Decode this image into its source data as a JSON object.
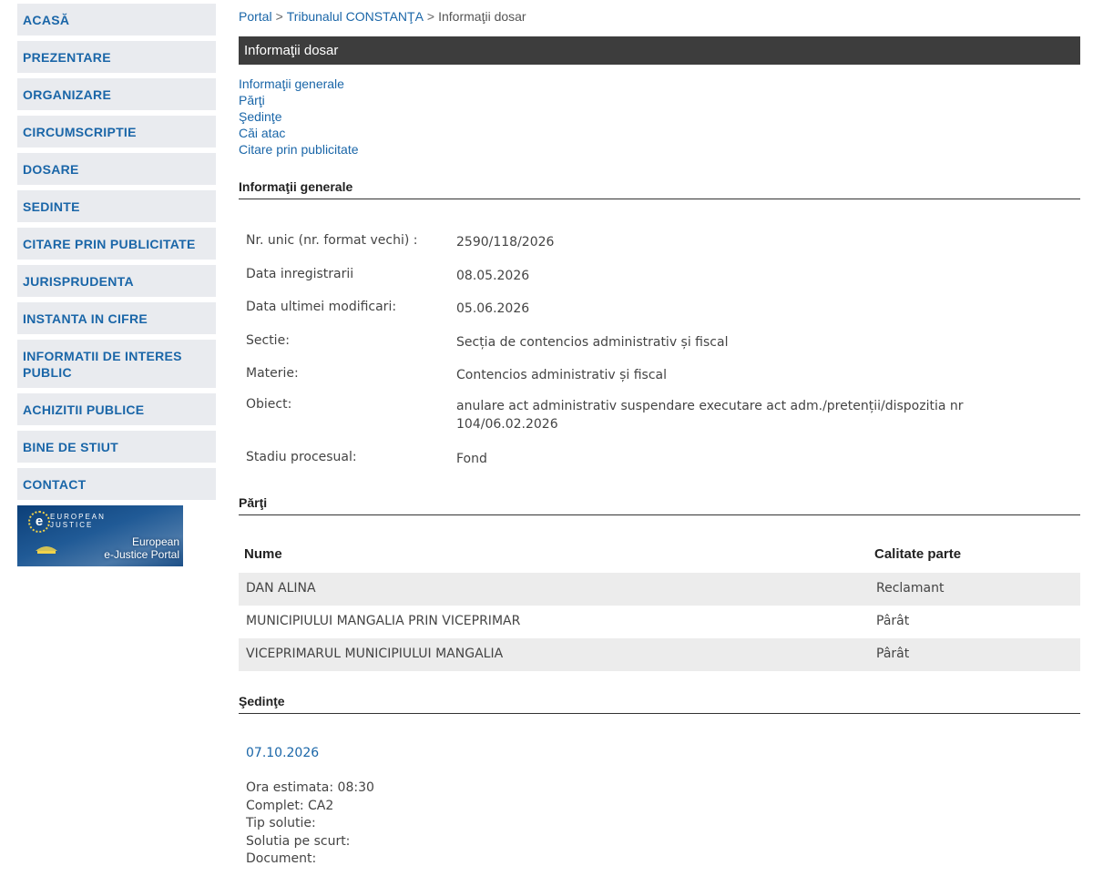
{
  "sidebar": {
    "items": [
      {
        "label": "ACASĂ"
      },
      {
        "label": "PREZENTARE"
      },
      {
        "label": "ORGANIZARE"
      },
      {
        "label": "CIRCUMSCRIPTIE"
      },
      {
        "label": "DOSARE"
      },
      {
        "label": "SEDINTE"
      },
      {
        "label": "CITARE PRIN PUBLICITATE"
      },
      {
        "label": "JURISPRUDENTA"
      },
      {
        "label": "INSTANTA IN CIFRE"
      },
      {
        "label": "INFORMATII DE INTERES PUBLIC"
      },
      {
        "label": "ACHIZITII PUBLICE"
      },
      {
        "label": "BINE DE STIUT"
      },
      {
        "label": "CONTACT"
      }
    ],
    "banner": {
      "logo_letter": "e",
      "small_line1": "EUROPEAN",
      "small_line2": "JUSTICE",
      "text_line1": "European",
      "text_line2": "e-Justice Portal"
    }
  },
  "breadcrumb": {
    "portal": "Portal",
    "court": "Tribunalul CONSTANŢA",
    "current": "Informaţii dosar",
    "separator": ">"
  },
  "page_title": "Informaţii dosar",
  "anchors": [
    "Informaţii generale",
    "Părţi",
    "Şedinţe",
    "Căi atac",
    "Citare prin publicitate"
  ],
  "general": {
    "heading": "Informaţii generale",
    "rows": [
      {
        "label": "Nr. unic (nr. format vechi) :",
        "value": "2590/118/2026"
      },
      {
        "label": "Data inregistrarii",
        "value": "08.05.2026"
      },
      {
        "label": "Data ultimei modificari:",
        "value": "05.06.2026"
      },
      {
        "label": "Sectie:",
        "value": "Secția de contencios administrativ și fiscal"
      },
      {
        "label": "Materie:",
        "value": "Contencios administrativ și fiscal"
      },
      {
        "label": "Obiect:",
        "value": "anulare act administrativ suspendare executare act adm./pretenții/dispozitia nr 104/06.02.2026"
      },
      {
        "label": "Stadiu procesual:",
        "value": "Fond"
      }
    ]
  },
  "parties": {
    "heading": "Părţi",
    "col_name": "Nume",
    "col_role": "Calitate parte",
    "rows": [
      {
        "name": "DAN ALINA",
        "role": "Reclamant"
      },
      {
        "name": "MUNICIPIULUI MANGALIA PRIN VICEPRIMAR",
        "role": "Pârât"
      },
      {
        "name": "VICEPRIMARUL MUNICIPIULUI MANGALIA",
        "role": "Pârât"
      }
    ]
  },
  "hearings": {
    "heading": "Şedinţe",
    "date": "07.10.2026",
    "lines": [
      "Ora estimata: 08:30",
      "Complet: CA2",
      "Tip solutie:",
      "Solutia pe scurt:",
      "Document:"
    ]
  },
  "colors": {
    "link": "#1a66a8",
    "nav_bg": "#e9ebef",
    "title_bar": "#3d3d3d",
    "row_alt": "#ececec"
  }
}
